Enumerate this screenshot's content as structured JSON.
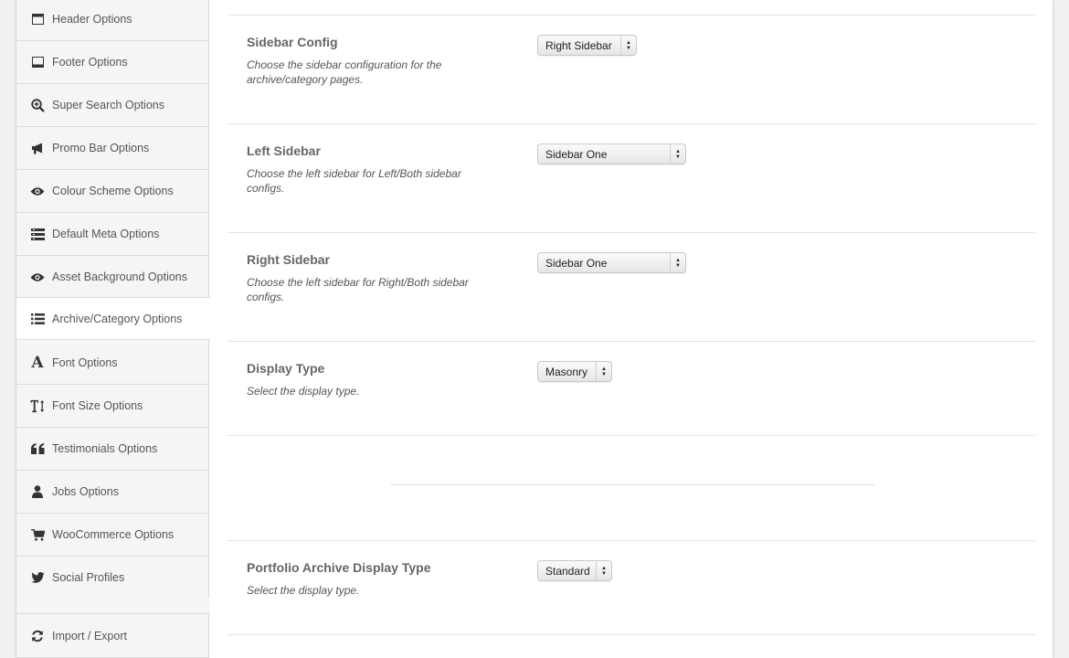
{
  "sidebar": {
    "items": [
      {
        "label": "Header Options",
        "icon": "header-icon"
      },
      {
        "label": "Footer Options",
        "icon": "footer-icon"
      },
      {
        "label": "Super Search Options",
        "icon": "search-plus-icon"
      },
      {
        "label": "Promo Bar Options",
        "icon": "megaphone-icon"
      },
      {
        "label": "Colour Scheme Options",
        "icon": "eye-icon"
      },
      {
        "label": "Default Meta Options",
        "icon": "meta-list-icon"
      },
      {
        "label": "Asset Background Options",
        "icon": "eye-icon"
      },
      {
        "label": "Archive/Category Options",
        "icon": "list-icon"
      },
      {
        "label": "Font Options",
        "icon": "font-icon"
      },
      {
        "label": "Font Size Options",
        "icon": "text-height-icon"
      },
      {
        "label": "Testimonials Options",
        "icon": "quote-icon"
      },
      {
        "label": "Jobs Options",
        "icon": "user-icon"
      },
      {
        "label": "WooCommerce Options",
        "icon": "cart-icon"
      },
      {
        "label": "Social Profiles",
        "icon": "twitter-icon"
      }
    ],
    "import_export": {
      "label": "Import / Export",
      "icon": "refresh-icon"
    }
  },
  "options": [
    {
      "title": "Sidebar Config",
      "desc": "Choose the sidebar configuration for the archive/category pages.",
      "value": "Right Sidebar"
    },
    {
      "title": "Left Sidebar",
      "desc": "Choose the left sidebar for Left/Both sidebar configs.",
      "value": "Sidebar One"
    },
    {
      "title": "Right Sidebar",
      "desc": "Choose the left sidebar for Right/Both sidebar configs.",
      "value": "Sidebar One"
    },
    {
      "title": "Display Type",
      "desc": "Select the display type.",
      "value": "Masonry"
    },
    {
      "title": "Portfolio Archive Display Type",
      "desc": "Select the display type.",
      "value": "Standard"
    }
  ]
}
